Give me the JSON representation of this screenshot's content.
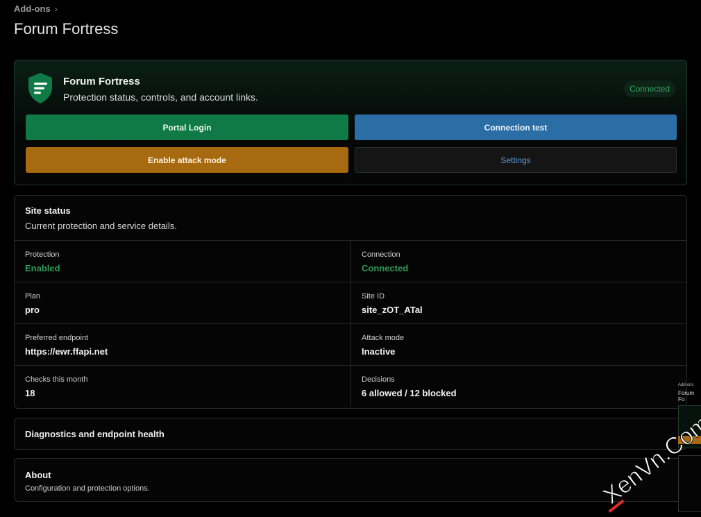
{
  "breadcrumb": {
    "label": "Add-ons",
    "chevron": "›"
  },
  "page": {
    "title": "Forum Fortress"
  },
  "hero": {
    "icon": "shield-icon",
    "name": "Forum Fortress",
    "subtitle": "Protection status, controls, and account links.",
    "badge": "Connected",
    "buttons": {
      "portal": "Portal Login",
      "test": "Connection test",
      "attack": "Enable attack mode",
      "settings": "Settings"
    }
  },
  "status": {
    "title": "Site status",
    "subtitle": "Current protection and service details.",
    "rows": [
      [
        {
          "label": "Protection",
          "value": "Enabled"
        },
        {
          "label": "Connection",
          "value": "Connected"
        }
      ],
      [
        {
          "label": "Plan",
          "value": "pro"
        },
        {
          "label": "Site ID",
          "value": "site_zOT_ATal"
        }
      ],
      [
        {
          "label": "Preferred endpoint",
          "value": "https://ewr.ffapi.net"
        },
        {
          "label": "Attack mode",
          "value": "Inactive"
        }
      ],
      [
        {
          "label": "Checks this month",
          "value": "18"
        },
        {
          "label": "Decisions",
          "value": "6 allowed / 12 blocked"
        }
      ]
    ]
  },
  "diagnostics": {
    "title": "Diagnostics and endpoint health"
  },
  "about": {
    "title": "About",
    "subtitle": "Configuration and protection options."
  },
  "thumbnail": {
    "crumb": "Add-ons",
    "title": "Forum Fo"
  },
  "watermark": {
    "text": "XenVn.Com"
  },
  "colors": {
    "background": "#000000",
    "success": "#0f7a46",
    "info": "#2b6ea5",
    "warning": "#a86a10",
    "status_ok": "#2f9a58",
    "watermark_red": "#e02a2a"
  }
}
